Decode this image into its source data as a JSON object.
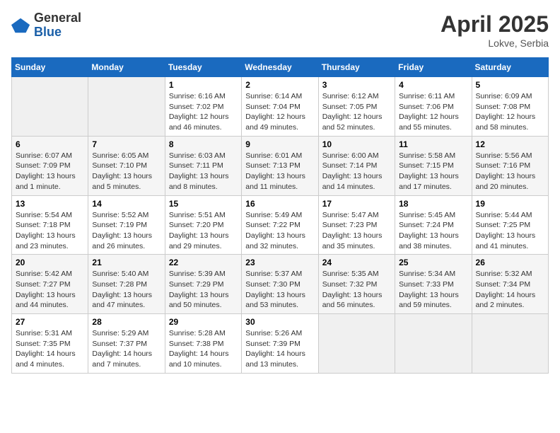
{
  "logo": {
    "general": "General",
    "blue": "Blue"
  },
  "title": {
    "month_year": "April 2025",
    "location": "Lokve, Serbia"
  },
  "days_of_week": [
    "Sunday",
    "Monday",
    "Tuesday",
    "Wednesday",
    "Thursday",
    "Friday",
    "Saturday"
  ],
  "weeks": [
    [
      {
        "day": "",
        "info": ""
      },
      {
        "day": "",
        "info": ""
      },
      {
        "day": "1",
        "info": "Sunrise: 6:16 AM\nSunset: 7:02 PM\nDaylight: 12 hours and 46 minutes."
      },
      {
        "day": "2",
        "info": "Sunrise: 6:14 AM\nSunset: 7:04 PM\nDaylight: 12 hours and 49 minutes."
      },
      {
        "day": "3",
        "info": "Sunrise: 6:12 AM\nSunset: 7:05 PM\nDaylight: 12 hours and 52 minutes."
      },
      {
        "day": "4",
        "info": "Sunrise: 6:11 AM\nSunset: 7:06 PM\nDaylight: 12 hours and 55 minutes."
      },
      {
        "day": "5",
        "info": "Sunrise: 6:09 AM\nSunset: 7:08 PM\nDaylight: 12 hours and 58 minutes."
      }
    ],
    [
      {
        "day": "6",
        "info": "Sunrise: 6:07 AM\nSunset: 7:09 PM\nDaylight: 13 hours and 1 minute."
      },
      {
        "day": "7",
        "info": "Sunrise: 6:05 AM\nSunset: 7:10 PM\nDaylight: 13 hours and 5 minutes."
      },
      {
        "day": "8",
        "info": "Sunrise: 6:03 AM\nSunset: 7:11 PM\nDaylight: 13 hours and 8 minutes."
      },
      {
        "day": "9",
        "info": "Sunrise: 6:01 AM\nSunset: 7:13 PM\nDaylight: 13 hours and 11 minutes."
      },
      {
        "day": "10",
        "info": "Sunrise: 6:00 AM\nSunset: 7:14 PM\nDaylight: 13 hours and 14 minutes."
      },
      {
        "day": "11",
        "info": "Sunrise: 5:58 AM\nSunset: 7:15 PM\nDaylight: 13 hours and 17 minutes."
      },
      {
        "day": "12",
        "info": "Sunrise: 5:56 AM\nSunset: 7:16 PM\nDaylight: 13 hours and 20 minutes."
      }
    ],
    [
      {
        "day": "13",
        "info": "Sunrise: 5:54 AM\nSunset: 7:18 PM\nDaylight: 13 hours and 23 minutes."
      },
      {
        "day": "14",
        "info": "Sunrise: 5:52 AM\nSunset: 7:19 PM\nDaylight: 13 hours and 26 minutes."
      },
      {
        "day": "15",
        "info": "Sunrise: 5:51 AM\nSunset: 7:20 PM\nDaylight: 13 hours and 29 minutes."
      },
      {
        "day": "16",
        "info": "Sunrise: 5:49 AM\nSunset: 7:22 PM\nDaylight: 13 hours and 32 minutes."
      },
      {
        "day": "17",
        "info": "Sunrise: 5:47 AM\nSunset: 7:23 PM\nDaylight: 13 hours and 35 minutes."
      },
      {
        "day": "18",
        "info": "Sunrise: 5:45 AM\nSunset: 7:24 PM\nDaylight: 13 hours and 38 minutes."
      },
      {
        "day": "19",
        "info": "Sunrise: 5:44 AM\nSunset: 7:25 PM\nDaylight: 13 hours and 41 minutes."
      }
    ],
    [
      {
        "day": "20",
        "info": "Sunrise: 5:42 AM\nSunset: 7:27 PM\nDaylight: 13 hours and 44 minutes."
      },
      {
        "day": "21",
        "info": "Sunrise: 5:40 AM\nSunset: 7:28 PM\nDaylight: 13 hours and 47 minutes."
      },
      {
        "day": "22",
        "info": "Sunrise: 5:39 AM\nSunset: 7:29 PM\nDaylight: 13 hours and 50 minutes."
      },
      {
        "day": "23",
        "info": "Sunrise: 5:37 AM\nSunset: 7:30 PM\nDaylight: 13 hours and 53 minutes."
      },
      {
        "day": "24",
        "info": "Sunrise: 5:35 AM\nSunset: 7:32 PM\nDaylight: 13 hours and 56 minutes."
      },
      {
        "day": "25",
        "info": "Sunrise: 5:34 AM\nSunset: 7:33 PM\nDaylight: 13 hours and 59 minutes."
      },
      {
        "day": "26",
        "info": "Sunrise: 5:32 AM\nSunset: 7:34 PM\nDaylight: 14 hours and 2 minutes."
      }
    ],
    [
      {
        "day": "27",
        "info": "Sunrise: 5:31 AM\nSunset: 7:35 PM\nDaylight: 14 hours and 4 minutes."
      },
      {
        "day": "28",
        "info": "Sunrise: 5:29 AM\nSunset: 7:37 PM\nDaylight: 14 hours and 7 minutes."
      },
      {
        "day": "29",
        "info": "Sunrise: 5:28 AM\nSunset: 7:38 PM\nDaylight: 14 hours and 10 minutes."
      },
      {
        "day": "30",
        "info": "Sunrise: 5:26 AM\nSunset: 7:39 PM\nDaylight: 14 hours and 13 minutes."
      },
      {
        "day": "",
        "info": ""
      },
      {
        "day": "",
        "info": ""
      },
      {
        "day": "",
        "info": ""
      }
    ]
  ]
}
